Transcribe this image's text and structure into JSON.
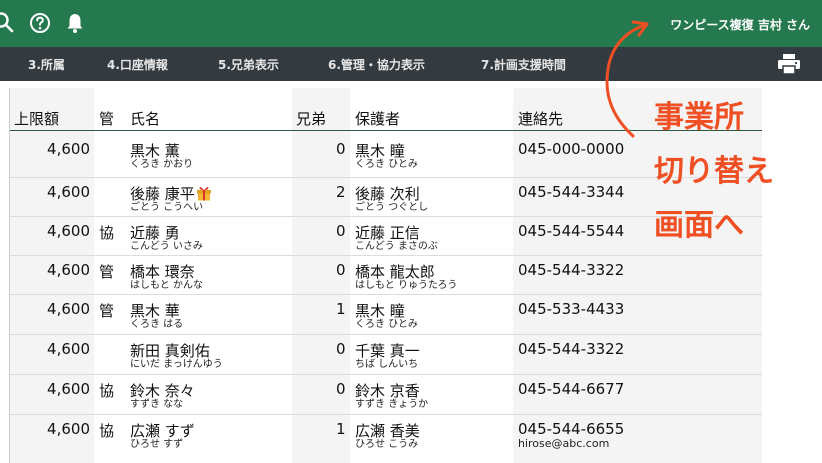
{
  "header": {
    "office_user": "ワンピース複復 吉村 さん"
  },
  "nav": {
    "tabs": [
      {
        "label": "3.所属"
      },
      {
        "label": "4.口座情報"
      },
      {
        "label": "5.兄弟表示"
      },
      {
        "label": "6.管理・協力表示"
      },
      {
        "label": "7.計画支援時間"
      }
    ]
  },
  "table": {
    "columns": [
      "上限額",
      "管",
      "氏名",
      "兄弟",
      "保護者",
      "連絡先"
    ],
    "rows": [
      {
        "limit": "4,600",
        "kan": "",
        "name": "黒木 薫",
        "name_kana": "くろき かおり",
        "siblings": "0",
        "guardian": "黒木 瞳",
        "guardian_kana": "くろき ひとみ",
        "contact": "045-000-0000",
        "email": ""
      },
      {
        "limit": "4,600",
        "kan": "",
        "name": "後藤 康平",
        "name_kana": "ごとう こうへい",
        "siblings": "2",
        "guardian": "後藤 次利",
        "guardian_kana": "ごとう つぐとし",
        "contact": "045-544-3344",
        "email": ""
      },
      {
        "limit": "4,600",
        "kan": "協",
        "name": "近藤 勇",
        "name_kana": "こんどう いさみ",
        "siblings": "0",
        "guardian": "近藤 正信",
        "guardian_kana": "こんどう まさのぶ",
        "contact": "045-544-5544",
        "email": ""
      },
      {
        "limit": "4,600",
        "kan": "管",
        "name": "橋本 環奈",
        "name_kana": "はしもと かんな",
        "siblings": "0",
        "guardian": "橋本 龍太郎",
        "guardian_kana": "はしもと りゅうたろう",
        "contact": "045-544-3322",
        "email": ""
      },
      {
        "limit": "4,600",
        "kan": "管",
        "name": "黒木 華",
        "name_kana": "くろき はる",
        "siblings": "1",
        "guardian": "黒木 瞳",
        "guardian_kana": "くろき ひとみ",
        "contact": "045-533-4433",
        "email": ""
      },
      {
        "limit": "4,600",
        "kan": "",
        "name": "新田 真剣佑",
        "name_kana": "にいだ まっけんゆう",
        "siblings": "0",
        "guardian": "千葉 真一",
        "guardian_kana": "ちば しんいち",
        "contact": "045-544-3322",
        "email": ""
      },
      {
        "limit": "4,600",
        "kan": "協",
        "name": "鈴木 奈々",
        "name_kana": "すずき なな",
        "siblings": "0",
        "guardian": "鈴木 京香",
        "guardian_kana": "すずき きょうか",
        "contact": "045-544-6677",
        "email": ""
      },
      {
        "limit": "4,600",
        "kan": "協",
        "name": "広瀬 すず",
        "name_kana": "ひろせ すず",
        "siblings": "1",
        "guardian": "広瀬 香美",
        "guardian_kana": "ひろせ こうみ",
        "contact": "045-544-6655",
        "email": "hirose@abc.com"
      }
    ]
  },
  "annotation": {
    "lines": [
      "事業所",
      "切り替え",
      "画面へ"
    ],
    "color": "#f04e23"
  },
  "colors": {
    "topbar": "#247a4e",
    "navbar": "#333a40"
  }
}
